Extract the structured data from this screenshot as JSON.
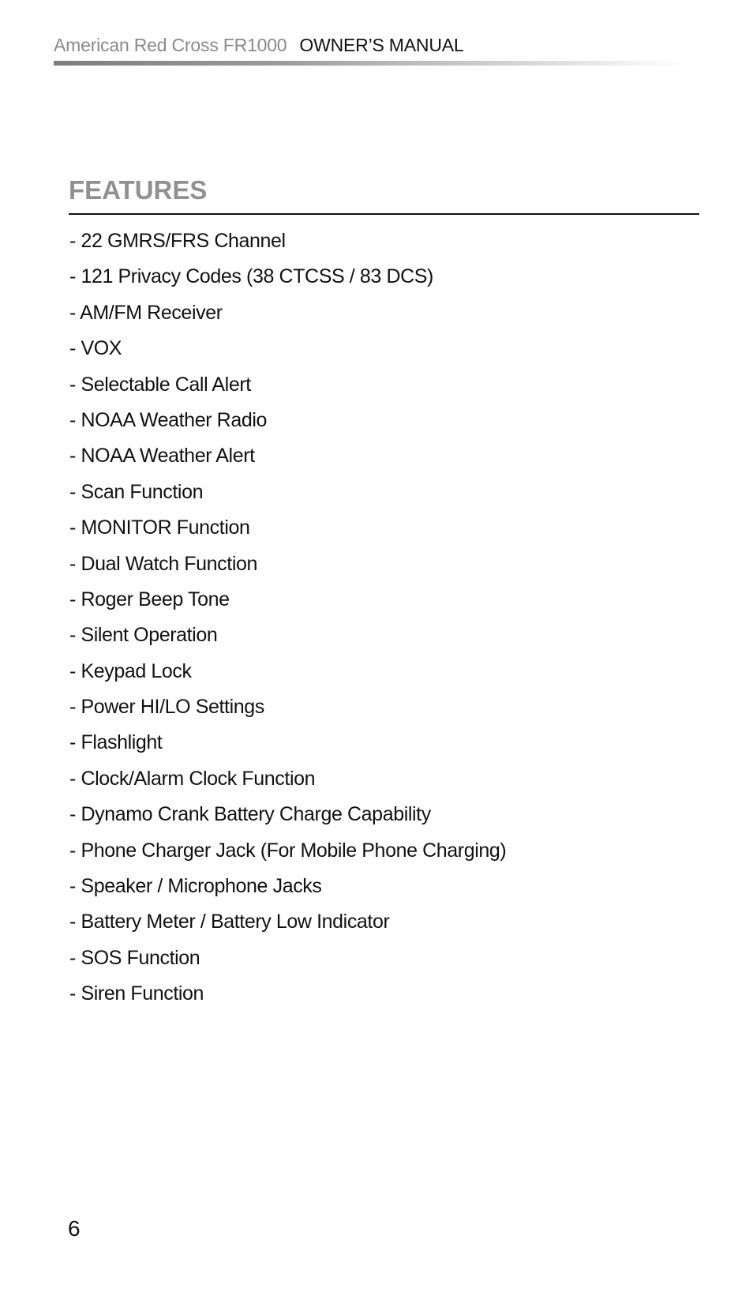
{
  "header": {
    "product": "American Red Cross FR1000",
    "manual": "OWNER’S MANUAL"
  },
  "section": {
    "title": "FEATURES",
    "items": [
      "- 22 GMRS/FRS Channel",
      "- 121 Privacy Codes (38 CTCSS / 83 DCS)",
      "- AM/FM Receiver",
      "- VOX",
      "- Selectable Call Alert",
      "- NOAA Weather Radio",
      "- NOAA Weather Alert",
      "- Scan Function",
      "- MONITOR Function",
      "- Dual Watch Function",
      "- Roger Beep Tone",
      "- Silent Operation",
      "- Keypad Lock",
      "- Power HI/LO Settings",
      "- Flashlight",
      "- Clock/Alarm Clock Function",
      "- Dynamo Crank Battery Charge Capability",
      "- Phone Charger Jack (For Mobile Phone Charging)",
      "- Speaker / Microphone Jacks",
      "- Battery Meter / Battery Low Indicator",
      "- SOS Function",
      "- Siren Function"
    ]
  },
  "footer": {
    "page_number": "6"
  },
  "colors": {
    "title_gray": "#8f9094",
    "header_gray": "#8a8a8a",
    "text": "#111111"
  }
}
